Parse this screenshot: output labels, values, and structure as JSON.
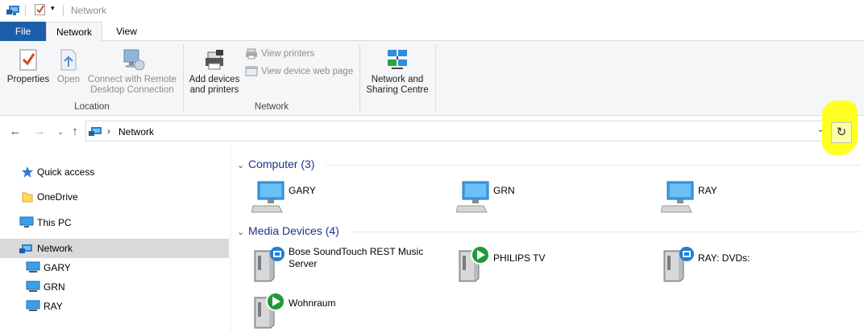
{
  "window": {
    "title": "Network"
  },
  "tabs": {
    "file": "File",
    "network": "Network",
    "view": "View"
  },
  "ribbon": {
    "properties": "Properties",
    "open": "Open",
    "connect_remote_1": "Connect with Remote",
    "connect_remote_2": "Desktop Connection",
    "location_group": "Location",
    "add_devices_1": "Add devices",
    "add_devices_2": "and printers",
    "view_printers": "View printers",
    "view_device_web": "View device web page",
    "network_group": "Network",
    "sharing_1": "Network and",
    "sharing_2": "Sharing Centre"
  },
  "address": {
    "crumb": "Network",
    "sep": "›"
  },
  "nav": {
    "quick_access": "Quick access",
    "onedrive": "OneDrive",
    "this_pc": "This PC",
    "network": "Network",
    "children": [
      "GARY",
      "GRN",
      "RAY"
    ]
  },
  "content": {
    "computer_group": "Computer (3)",
    "computers": [
      "GARY",
      "GRN",
      "RAY"
    ],
    "media_group": "Media Devices (4)",
    "media": [
      "Bose SoundTouch REST Music Server",
      "PHILIPS TV",
      "RAY: DVDs:",
      "Wohnraum"
    ]
  },
  "colors": {
    "accent": "#1c5ea8",
    "group_header": "#1e3287",
    "highlight": "#ffff22"
  }
}
